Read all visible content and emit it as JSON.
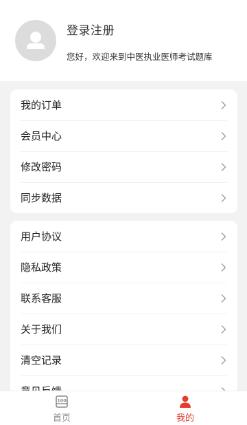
{
  "profile": {
    "avatar_icon": "user-avatar-icon",
    "login_label": "登录注册",
    "welcome_text": "您好，欢迎来到中医执业医师考试题库"
  },
  "menu_group_1": [
    {
      "label": "我的订单"
    },
    {
      "label": "会员中心"
    },
    {
      "label": "修改密码"
    },
    {
      "label": "同步数据"
    }
  ],
  "menu_group_2": [
    {
      "label": "用户协议"
    },
    {
      "label": "隐私政策"
    },
    {
      "label": "联系客服"
    },
    {
      "label": "关于我们"
    },
    {
      "label": "清空记录"
    },
    {
      "label": "意见反馈"
    }
  ],
  "tabbar": {
    "home_label": "首页",
    "home_icon": "home-book-icon",
    "mine_label": "我的",
    "mine_icon": "person-icon",
    "active": "mine",
    "active_color": "#e43d30",
    "inactive_color": "#8a8a8a"
  }
}
